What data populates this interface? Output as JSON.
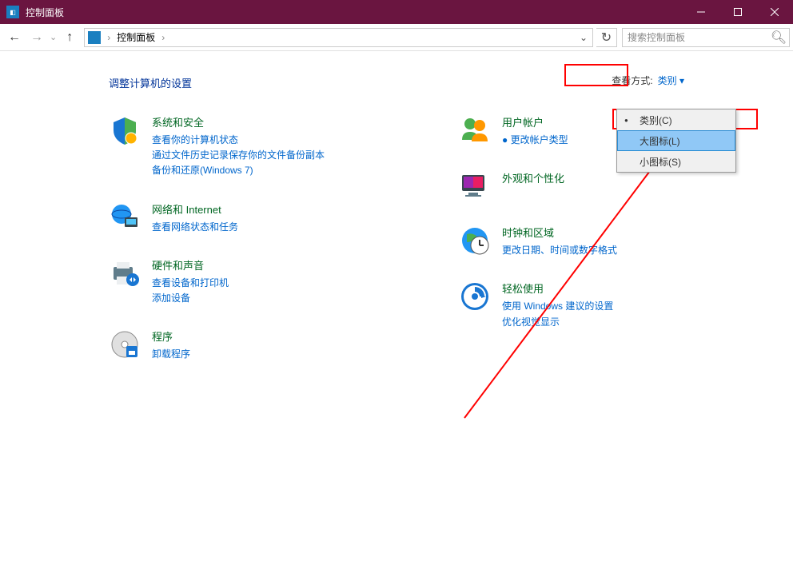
{
  "titlebar": {
    "title": "控制面板"
  },
  "toolbar": {
    "address": "控制面板",
    "search_placeholder": "搜索控制面板"
  },
  "content": {
    "heading": "调整计算机的设置",
    "view_by_label": "查看方式:",
    "view_by_value": "类别",
    "dropdown": {
      "options": [
        {
          "label": "类别(C)",
          "selected": true,
          "hover": false
        },
        {
          "label": "大图标(L)",
          "selected": false,
          "hover": true
        },
        {
          "label": "小图标(S)",
          "selected": false,
          "hover": false
        }
      ]
    },
    "left_col": [
      {
        "title": "系统和安全",
        "icon": "shield",
        "links": [
          "查看你的计算机状态",
          "通过文件历史记录保存你的文件备份副本",
          "备份和还原(Windows 7)"
        ]
      },
      {
        "title": "网络和 Internet",
        "icon": "globe",
        "links": [
          "查看网络状态和任务"
        ]
      },
      {
        "title": "硬件和声音",
        "icon": "printer",
        "links": [
          "查看设备和打印机",
          "添加设备"
        ]
      },
      {
        "title": "程序",
        "icon": "disc",
        "links": [
          "卸载程序"
        ]
      }
    ],
    "right_col": [
      {
        "title": "用户帐户",
        "icon": "users",
        "links": [
          "● 更改帐户类型"
        ]
      },
      {
        "title": "外观和个性化",
        "icon": "appearance",
        "links": []
      },
      {
        "title": "时钟和区域",
        "icon": "clock",
        "links": [
          "更改日期、时间或数字格式"
        ]
      },
      {
        "title": "轻松使用",
        "icon": "ease",
        "links": [
          "使用 Windows 建议的设置",
          "优化视觉显示"
        ]
      }
    ]
  }
}
